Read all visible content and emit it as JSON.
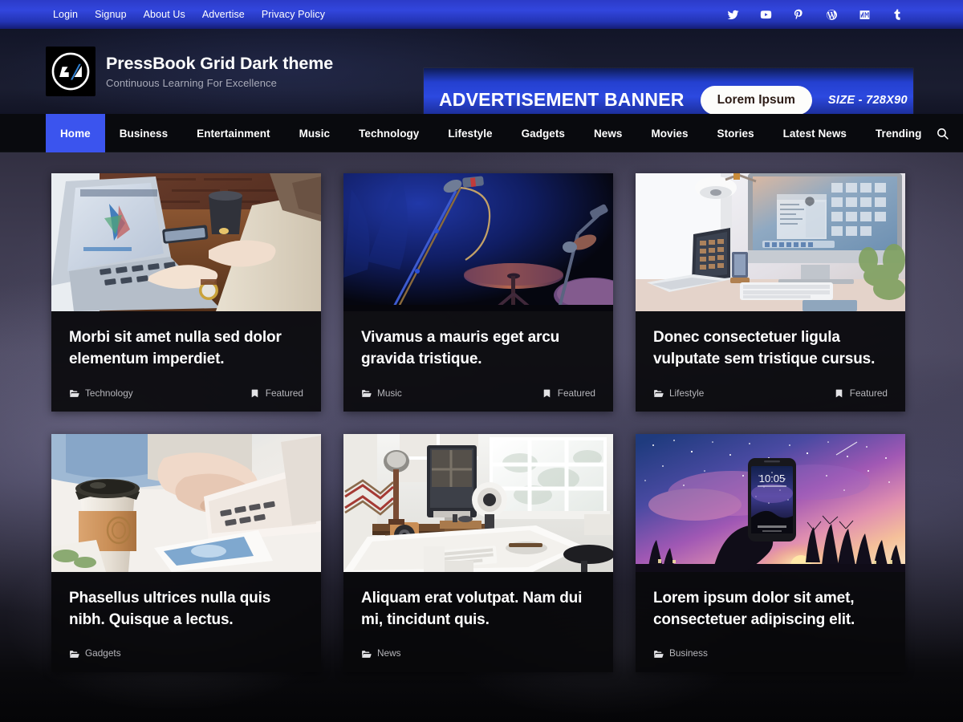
{
  "topbar": {
    "links": [
      {
        "label": "Login",
        "name": "login"
      },
      {
        "label": "Signup",
        "name": "signup"
      },
      {
        "label": "About Us",
        "name": "about-us"
      },
      {
        "label": "Advertise",
        "name": "advertise"
      },
      {
        "label": "Privacy Policy",
        "name": "privacy-policy"
      }
    ],
    "social": [
      {
        "icon": "twitter-icon"
      },
      {
        "icon": "youtube-icon"
      },
      {
        "icon": "pinterest-icon"
      },
      {
        "icon": "wordpress-icon"
      },
      {
        "icon": "medium-icon"
      },
      {
        "icon": "tumblr-icon"
      }
    ],
    "background_color": "#3246dd"
  },
  "header": {
    "logo_icon": "pressbook-logo-icon",
    "site_title": "PressBook Grid Dark theme",
    "tagline": "Continuous Learning For Excellence",
    "ad": {
      "title": "ADVERTISEMENT BANNER",
      "pill_label": "Lorem Ipsum",
      "size_label": "SIZE - 728X90",
      "background_color": "#2c49e0"
    }
  },
  "nav": {
    "active_color": "#3b54ee",
    "items": [
      {
        "label": "Home",
        "active": true
      },
      {
        "label": "Business",
        "active": false
      },
      {
        "label": "Entertainment",
        "active": false
      },
      {
        "label": "Music",
        "active": false
      },
      {
        "label": "Technology",
        "active": false
      },
      {
        "label": "Lifestyle",
        "active": false
      },
      {
        "label": "Gadgets",
        "active": false
      },
      {
        "label": "News",
        "active": false
      },
      {
        "label": "Movies",
        "active": false
      },
      {
        "label": "Stories",
        "active": false
      },
      {
        "label": "Latest News",
        "active": false
      },
      {
        "label": "Trending",
        "active": false
      }
    ],
    "search_icon": "search-icon"
  },
  "posts": [
    {
      "title": "Morbi sit amet nulla sed dolor elementum imperdiet.",
      "category": "Technology",
      "badge": "Featured",
      "image": "laptop-typing-brick-wall-photo"
    },
    {
      "title": "Vivamus a mauris eget arcu gravida tristique.",
      "category": "Music",
      "badge": "Featured",
      "image": "stage-microphone-drums-photo"
    },
    {
      "title": "Donec consectetuer ligula vulputate sem tristique cursus.",
      "category": "Lifestyle",
      "badge": "Featured",
      "image": "imac-desk-setup-photo"
    },
    {
      "title": "Phasellus ultrices nulla quis nibh. Quisque a lectus.",
      "category": "Gadgets",
      "badge": "",
      "image": "coffee-cup-laptop-photo"
    },
    {
      "title": "Aliquam erat volutpat. Nam dui mi, tincidunt quis.",
      "category": "News",
      "badge": "",
      "image": "home-office-window-photo"
    },
    {
      "title": "Lorem ipsum dolor sit amet, consectetuer adipiscing elit.",
      "category": "Business",
      "badge": "",
      "image": "phone-starry-sunset-photo"
    }
  ],
  "icons": {
    "category_icon": "folder-open-icon",
    "badge_icon": "bookmark-icon"
  }
}
